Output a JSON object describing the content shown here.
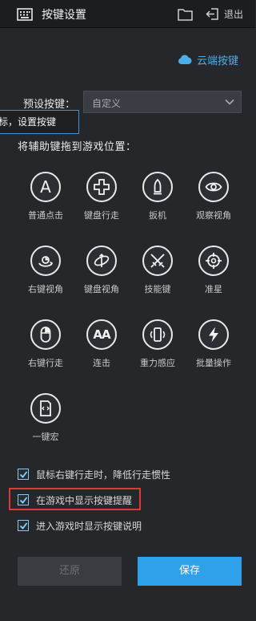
{
  "header": {
    "title": "按键设置",
    "exit_label": "退出"
  },
  "cloud": {
    "label": "云端按键"
  },
  "preset": {
    "label": "预设按键：",
    "selected": "自定义"
  },
  "tooltip": {
    "text": "鼠标，设置按键"
  },
  "drag_label": "将辅助键拖到游戏位置：",
  "keys": [
    {
      "label": "普通点击",
      "icon": "a-letter-icon"
    },
    {
      "label": "键盘行走",
      "icon": "dpad-icon"
    },
    {
      "label": "扳机",
      "icon": "bullet-icon"
    },
    {
      "label": "观察视角",
      "icon": "eye-icon"
    },
    {
      "label": "右键视角",
      "icon": "rotate-view-icon"
    },
    {
      "label": "键盘视角",
      "icon": "orbit-icon"
    },
    {
      "label": "技能键",
      "icon": "swords-icon"
    },
    {
      "label": "准星",
      "icon": "crosshair-icon"
    },
    {
      "label": "右键行走",
      "icon": "mouse-icon"
    },
    {
      "label": "连击",
      "icon": "aa-letters-icon"
    },
    {
      "label": "重力感应",
      "icon": "phone-tilt-icon"
    },
    {
      "label": "批量操作",
      "icon": "lightning-icon"
    },
    {
      "label": "一键宏",
      "icon": "script-icon"
    }
  ],
  "a_glyph": "A",
  "aa_glyph": "AA",
  "options": [
    {
      "label": "鼠标右键行走时，降低行走惯性",
      "checked": true
    },
    {
      "label": "在游戏中显示按键提醒",
      "checked": true
    },
    {
      "label": "进入游戏时显示按键说明",
      "checked": true
    }
  ],
  "buttons": {
    "reset": "还原",
    "save": "保存"
  },
  "colors": {
    "accent": "#2fa0ea",
    "highlight": "#d93a3a"
  }
}
